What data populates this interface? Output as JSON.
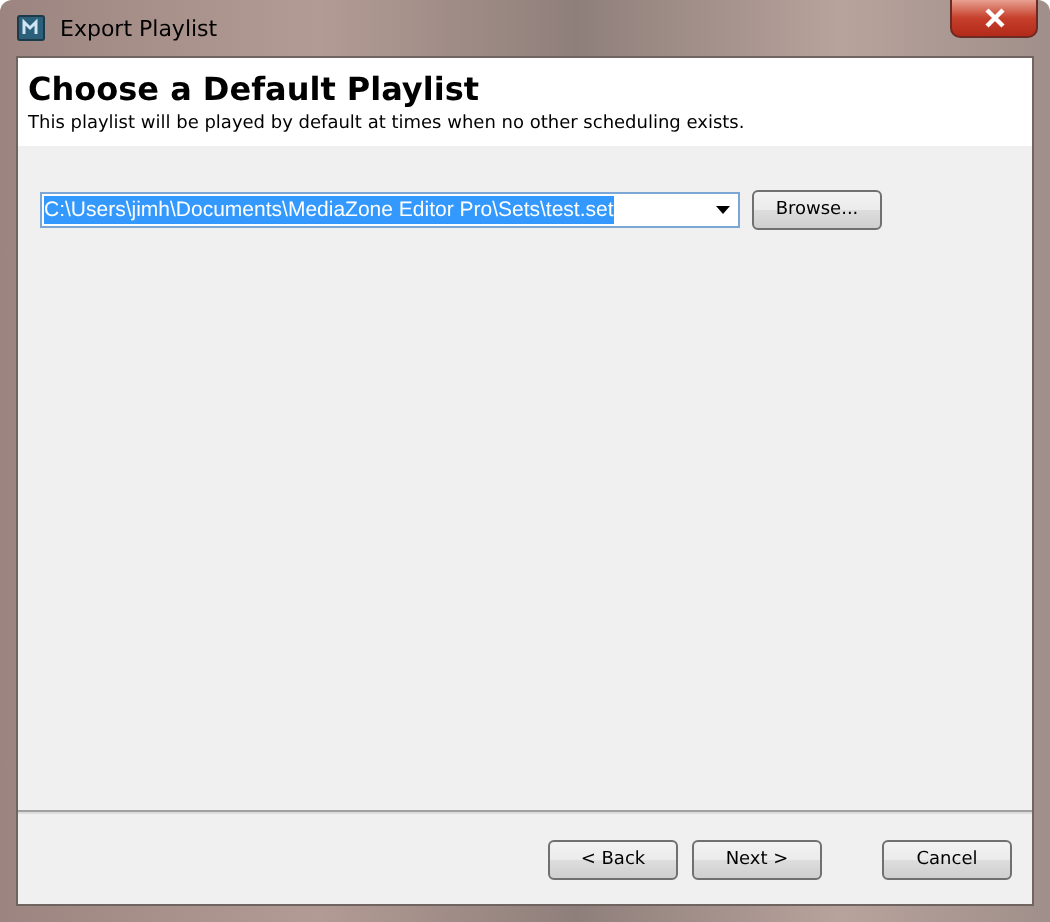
{
  "window": {
    "title": "Export Playlist"
  },
  "header": {
    "title": "Choose a Default Playlist",
    "subtitle": "This playlist will be played by default at times when no other scheduling exists."
  },
  "playlist_combo": {
    "value": "C:\\Users\\jimh\\Documents\\MediaZone Editor Pro\\Sets\\test.set",
    "selected": true
  },
  "browse_button": "Browse...",
  "buttons": [
    {
      "label": "< Back",
      "kind": "nav"
    },
    {
      "label": "Next >",
      "kind": "nav"
    },
    {
      "label": "Cancel",
      "kind": "cancel"
    }
  ]
}
